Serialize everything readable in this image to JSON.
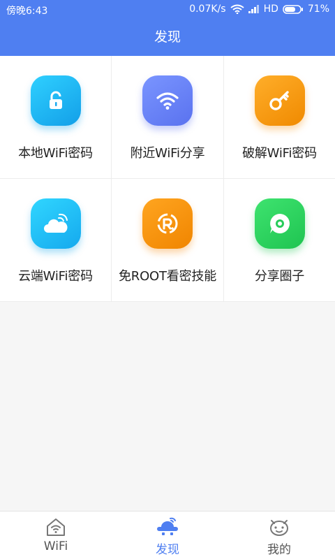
{
  "status": {
    "time": "傍晚6:43",
    "speed": "0.07K/s",
    "hd": "HD",
    "battery": "71%"
  },
  "header": {
    "title": "发现"
  },
  "features": [
    {
      "label": "本地WiFi密码",
      "icon": "unlock-icon",
      "color": "#1aa8ef"
    },
    {
      "label": "附近WiFi分享",
      "icon": "wifi-icon",
      "color": "#6180f4"
    },
    {
      "label": "破解WiFi密码",
      "icon": "key-icon",
      "color": "#f5960f"
    },
    {
      "label": "云端WiFi密码",
      "icon": "cloud-wifi-icon",
      "color": "#1caff0"
    },
    {
      "label": "免ROOT看密技能",
      "icon": "root-icon",
      "color": "#f38d0b"
    },
    {
      "label": "分享圈子",
      "icon": "chat-icon",
      "color": "#28cc5a"
    }
  ],
  "tabs": [
    {
      "label": "WiFi",
      "icon": "home-wifi-icon",
      "active": false
    },
    {
      "label": "发现",
      "icon": "ufo-icon",
      "active": true
    },
    {
      "label": "我的",
      "icon": "face-icon",
      "active": false
    }
  ],
  "accent": "#4f7ff1"
}
